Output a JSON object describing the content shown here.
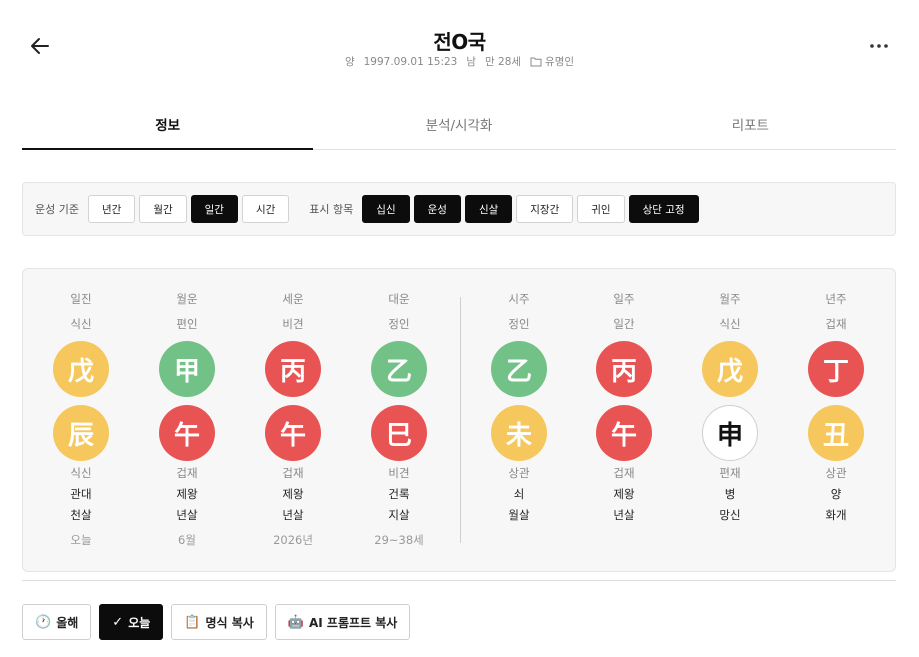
{
  "header": {
    "title": "전O국",
    "calendar": "양",
    "birth": "1997.09.01 15:23",
    "gender": "남",
    "age": "만 28세",
    "group": "유명인"
  },
  "tabs": [
    {
      "label": "정보",
      "active": true
    },
    {
      "label": "분석/시각화",
      "active": false
    },
    {
      "label": "리포트",
      "active": false
    }
  ],
  "filters": {
    "basis_label": "운성 기준",
    "basis_options": [
      {
        "label": "년간",
        "on": false
      },
      {
        "label": "월간",
        "on": false
      },
      {
        "label": "일간",
        "on": true
      },
      {
        "label": "시간",
        "on": false
      }
    ],
    "display_label": "표시 항목",
    "display_options": [
      {
        "label": "십신",
        "on": true
      },
      {
        "label": "운성",
        "on": true
      },
      {
        "label": "신살",
        "on": true
      },
      {
        "label": "지장간",
        "on": false
      },
      {
        "label": "귀인",
        "on": false
      },
      {
        "label": "상단 고정",
        "on": true
      }
    ]
  },
  "chart": {
    "luck_columns": [
      {
        "label": "일진",
        "god_top": "식신",
        "stem": "戊",
        "stem_color": "#f6c75c",
        "branch": "辰",
        "branch_color": "#f6c75c",
        "god_bottom": "식신",
        "stage": "관대",
        "spirit": "천살",
        "period": "오늘"
      },
      {
        "label": "월운",
        "god_top": "편인",
        "stem": "甲",
        "stem_color": "#72c187",
        "branch": "午",
        "branch_color": "#e85454",
        "god_bottom": "겁재",
        "stage": "제왕",
        "spirit": "년살",
        "period": "6월"
      },
      {
        "label": "세운",
        "god_top": "비견",
        "stem": "丙",
        "stem_color": "#e85454",
        "branch": "午",
        "branch_color": "#e85454",
        "god_bottom": "겁재",
        "stage": "제왕",
        "spirit": "년살",
        "period": "2026년"
      },
      {
        "label": "대운",
        "god_top": "정인",
        "stem": "乙",
        "stem_color": "#72c187",
        "branch": "巳",
        "branch_color": "#e85454",
        "god_bottom": "비견",
        "stage": "건록",
        "spirit": "지살",
        "period": "29~38세"
      }
    ],
    "pillar_columns": [
      {
        "label": "시주",
        "god_top": "정인",
        "stem": "乙",
        "stem_color": "#72c187",
        "branch": "未",
        "branch_color": "#f6c75c",
        "god_bottom": "상관",
        "stage": "쇠",
        "spirit": "월살"
      },
      {
        "label": "일주",
        "god_top": "일간",
        "stem": "丙",
        "stem_color": "#e85454",
        "branch": "午",
        "branch_color": "#e85454",
        "god_bottom": "겁재",
        "stage": "제왕",
        "spirit": "년살"
      },
      {
        "label": "월주",
        "god_top": "식신",
        "stem": "戊",
        "stem_color": "#f6c75c",
        "branch": "申",
        "branch_color": "#ffffff",
        "god_bottom": "편재",
        "stage": "병",
        "spirit": "망신"
      },
      {
        "label": "년주",
        "god_top": "겁재",
        "stem": "丁",
        "stem_color": "#e85454",
        "branch": "丑",
        "branch_color": "#f6c75c",
        "god_bottom": "상관",
        "stage": "양",
        "spirit": "화개"
      }
    ]
  },
  "actions": [
    {
      "label": "올해",
      "icon": "🕐",
      "icon_name": "clock-icon",
      "on": false
    },
    {
      "label": "오늘",
      "icon": "✓",
      "icon_name": "check-icon",
      "on": true
    },
    {
      "label": "명식 복사",
      "icon": "📋",
      "icon_name": "clipboard-icon",
      "on": false
    },
    {
      "label": "AI 프롬프트 복사",
      "icon": "🤖",
      "icon_name": "robot-icon",
      "on": false
    }
  ]
}
